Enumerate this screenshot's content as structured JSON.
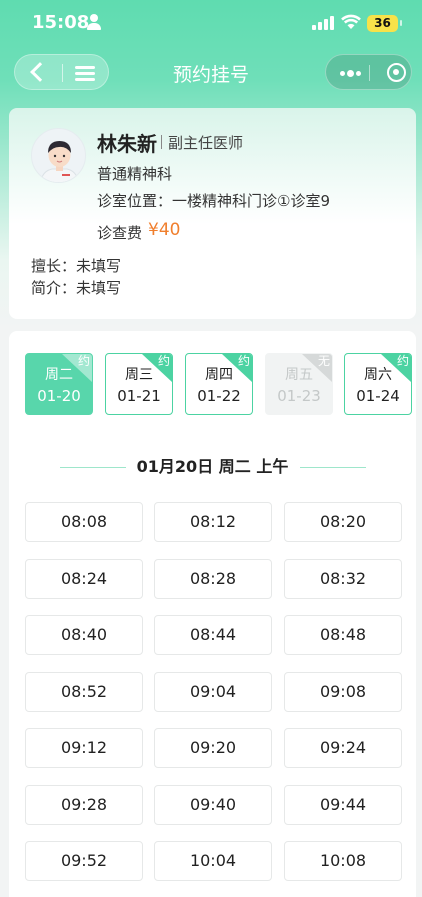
{
  "status_bar": {
    "time": "15:08",
    "battery": "36"
  },
  "nav": {
    "title": "预约挂号"
  },
  "doctor": {
    "name": "林朱新",
    "title": "副主任医师",
    "department": "普通精神科",
    "room": "诊室位置：一楼精神科门诊①诊室9",
    "fee_label": "诊查费",
    "fee": "¥40",
    "specialty": "擅长：未填写",
    "intro": "简介：未填写"
  },
  "date_tabs": [
    {
      "weekday": "周二",
      "date": "01-20",
      "badge": "约",
      "state": "active"
    },
    {
      "weekday": "周三",
      "date": "01-21",
      "badge": "约",
      "state": "available"
    },
    {
      "weekday": "周四",
      "date": "01-22",
      "badge": "约",
      "state": "available"
    },
    {
      "weekday": "周五",
      "date": "01-23",
      "badge": "无",
      "state": "full"
    },
    {
      "weekday": "周六",
      "date": "01-24",
      "badge": "约",
      "state": "available"
    }
  ],
  "session": {
    "title": "01月20日 周二 上午"
  },
  "slots": [
    "08:08",
    "08:12",
    "08:20",
    "08:24",
    "08:28",
    "08:32",
    "08:40",
    "08:44",
    "08:48",
    "08:52",
    "09:04",
    "09:08",
    "09:12",
    "09:20",
    "09:24",
    "09:28",
    "09:40",
    "09:44",
    "09:52",
    "10:04",
    "10:08"
  ],
  "colors": {
    "accent": "#58d6ab",
    "fee": "#f07f2d",
    "disabled": "#f1f3f3"
  }
}
